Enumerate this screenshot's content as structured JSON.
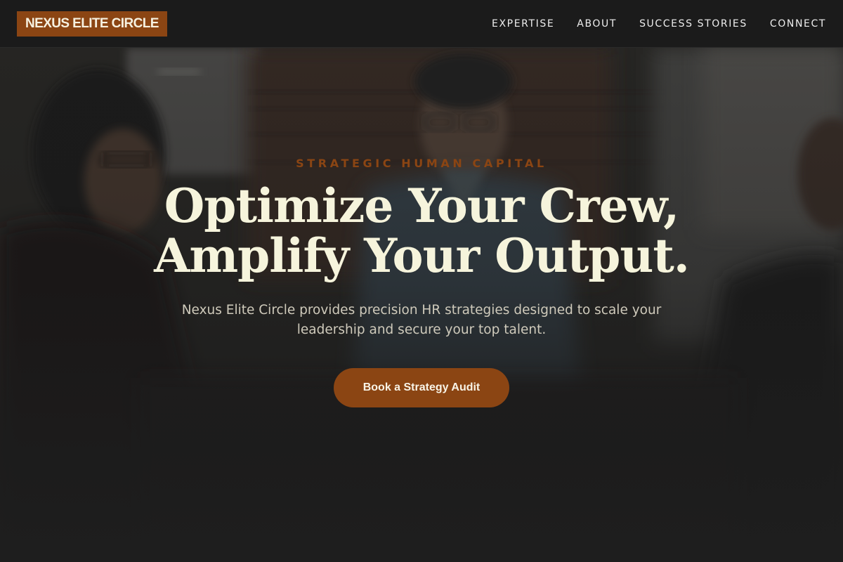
{
  "brand": {
    "logo_text": "NEXUS ELITE CIRCLE"
  },
  "nav": {
    "items": [
      {
        "label": "EXPERTISE"
      },
      {
        "label": "ABOUT"
      },
      {
        "label": "SUCCESS STORIES"
      },
      {
        "label": "CONNECT"
      }
    ]
  },
  "hero": {
    "eyebrow": "STRATEGIC HUMAN CAPITAL",
    "headline_line1": "Optimize Your Crew,",
    "headline_line2": "Amplify Your Output.",
    "subtitle": "Nexus Elite Circle provides precision HR strategies designed to scale your leadership and secure your top talent.",
    "cta_label": "Book a Strategy Audit"
  },
  "colors": {
    "accent": "#8b4513",
    "nav_background": "#1b1b1b",
    "page_background": "#1e1e1e",
    "headline": "#f6f4dc",
    "body_text": "#cfcabb"
  },
  "icons": {
    "hero_image": "meeting-photo"
  }
}
